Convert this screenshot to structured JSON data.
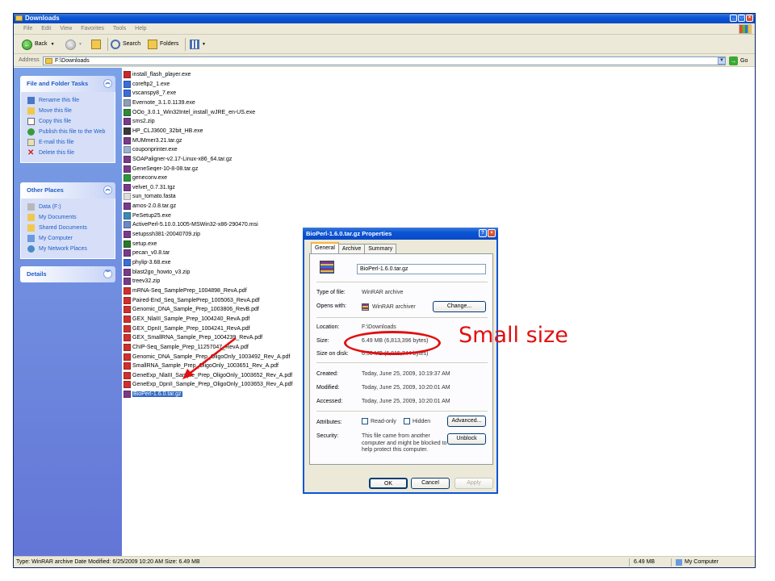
{
  "window": {
    "title": "Downloads",
    "menu": [
      "File",
      "Edit",
      "View",
      "Favorites",
      "Tools",
      "Help"
    ],
    "toolbar": {
      "back": "Back",
      "search": "Search",
      "folders": "Folders"
    },
    "address_label": "Address",
    "address_value": "F:\\Downloads",
    "go_label": "Go"
  },
  "taskpane": {
    "file_tasks": {
      "title": "File and Folder Tasks",
      "items": [
        "Rename this file",
        "Move this file",
        "Copy this file",
        "Publish this file to the Web",
        "E-mail this file",
        "Delete this file"
      ]
    },
    "other_places": {
      "title": "Other Places",
      "items": [
        "Data (F:)",
        "My Documents",
        "Shared Documents",
        "My Computer",
        "My Network Places"
      ]
    },
    "details": {
      "title": "Details"
    }
  },
  "files": [
    {
      "name": "install_flash_player.exe",
      "color": "#c8282c"
    },
    {
      "name": "coreftp2_1.exe",
      "color": "#3b6fd8"
    },
    {
      "name": "vscanspy8_7.exe",
      "color": "#3b6fd8"
    },
    {
      "name": "Evernote_3.1.0.1139.exe",
      "color": "#8ea0b8"
    },
    {
      "name": "OOo_3.0.1_Win32Intel_install_wJRE_en-US.exe",
      "color": "#2f8a3a"
    },
    {
      "name": "sms2.zip",
      "color": "#7a3a8a"
    },
    {
      "name": "HP_CLJ3600_32bit_HB.exe",
      "color": "#3a3a3a"
    },
    {
      "name": "MUMmer3.21.tar.gz",
      "color": "#7a3a8a"
    },
    {
      "name": "couponprinter.exe",
      "color": "#9ab0d0"
    },
    {
      "name": "SOAPaligner-v2.17-Linux-x86_64.tar.gz",
      "color": "#7a3a8a"
    },
    {
      "name": "GeneSeqer-10-8-08.tar.gz",
      "color": "#7a3a8a"
    },
    {
      "name": "geneconv.exe",
      "color": "#2a9a3a"
    },
    {
      "name": "velvet_0.7.31.tgz",
      "color": "#7a3a8a"
    },
    {
      "name": "sun_tomato.fasta",
      "color": "#dddddd"
    },
    {
      "name": "amos-2.0.8.tar.gz",
      "color": "#7a3a8a"
    },
    {
      "name": "PeSetup25.exe",
      "color": "#3a8ab8"
    },
    {
      "name": "ActivePerl-5.10.0.1005-MSWin32-x86-290470.msi",
      "color": "#6a8ac8"
    },
    {
      "name": "setupssh381-20040709.zip",
      "color": "#7a3a8a"
    },
    {
      "name": "setup.exe",
      "color": "#2a7a2a"
    },
    {
      "name": "pecan_v0.8.tar",
      "color": "#7a3a8a"
    },
    {
      "name": "phylip-3.68.exe",
      "color": "#3b6fd8"
    },
    {
      "name": "blast2go_howto_v3.zip",
      "color": "#7a3a8a"
    },
    {
      "name": "treev32.zip",
      "color": "#7a3a8a"
    },
    {
      "name": "mRNA-Seq_SamplePrep_1004898_RevA.pdf",
      "color": "#d0302c"
    },
    {
      "name": "Paired-End_Seq_SamplePrep_1005063_RevA.pdf",
      "color": "#d0302c"
    },
    {
      "name": "Genomic_DNA_Sample_Prep_1003806_RevB.pdf",
      "color": "#d0302c"
    },
    {
      "name": "GEX_NlaIII_Sample_Prep_1004240_RevA.pdf",
      "color": "#d0302c"
    },
    {
      "name": "GEX_DpnII_Sample_Prep_1004241_RevA.pdf",
      "color": "#d0302c"
    },
    {
      "name": "GEX_SmallRNA_Sample_Prep_1004239_RevA.pdf",
      "color": "#d0302c"
    },
    {
      "name": "ChIP-Seq_Sample_Prep_11257047_RevA.pdf",
      "color": "#d0302c"
    },
    {
      "name": "Genomic_DNA_Sample_Prep_OligoOnly_1003492_Rev_A.pdf",
      "color": "#d0302c"
    },
    {
      "name": "SmallRNA_Sample_Prep_OligoOnly_1003651_Rev_A.pdf",
      "color": "#d0302c"
    },
    {
      "name": "GeneExp_NlaIII_Sample_Prep_OligoOnly_1003652_Rev_A.pdf",
      "color": "#d0302c"
    },
    {
      "name": "GeneExp_DpnII_Sample_Prep_OligoOnly_1003653_Rev_A.pdf",
      "color": "#d0302c"
    },
    {
      "name": "BioPerl-1.6.0.tar.gz",
      "color": "#7a3a8a",
      "selected": true
    }
  ],
  "status": {
    "text": "Type: WinRAR archive Date Modified: 6/25/2009 10:20 AM Size: 6.49 MB",
    "size": "6.49 MB",
    "location": "My Computer"
  },
  "dialog": {
    "title": "BioPerl-1.6.0.tar.gz Properties",
    "tabs": [
      "General",
      "Archive",
      "Summary"
    ],
    "filename": "BioPerl-1.6.0.tar.gz",
    "type_label": "Type of file:",
    "type_value": "WinRAR archive",
    "opens_label": "Opens with:",
    "opens_value": "WinRAR archiver",
    "change_button": "Change...",
    "location_label": "Location:",
    "location_value": "F:\\Downloads",
    "size_label": "Size:",
    "size_value": "6.49 MB (6,813,396 bytes)",
    "size_on_disk_label": "Size on disk:",
    "size_on_disk_value": "6.50 MB (6,815,744 bytes)",
    "created_label": "Created:",
    "created_value": "Today, June 25, 2009, 10:19:37 AM",
    "modified_label": "Modified:",
    "modified_value": "Today, June 25, 2009, 10:20:01 AM",
    "accessed_label": "Accessed:",
    "accessed_value": "Today, June 25, 2009, 10:20:01 AM",
    "attributes_label": "Attributes:",
    "readonly_label": "Read-only",
    "hidden_label": "Hidden",
    "advanced_button": "Advanced...",
    "security_label": "Security:",
    "security_text": "This file came from another computer and might be blocked to help protect this computer.",
    "unblock_button": "Unblock",
    "ok_button": "OK",
    "cancel_button": "Cancel",
    "apply_button": "Apply"
  },
  "annotation": {
    "text": "Small size",
    "color": "#e01010"
  }
}
